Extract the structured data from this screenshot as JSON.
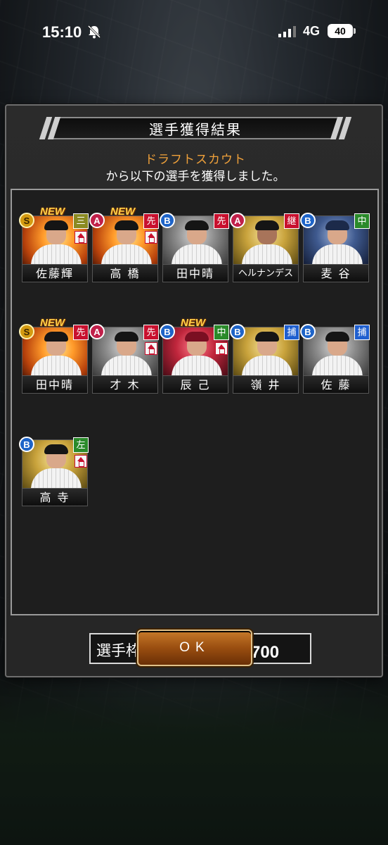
{
  "status_bar": {
    "time": "15:10",
    "network": "4G",
    "battery": "40"
  },
  "dialog": {
    "title": "選手獲得結果",
    "source_name": "ドラフトスカウト",
    "message": "から以下の選手を獲得しました。",
    "counter_label": "選手枠：",
    "counter_value": "623／700",
    "ok_label": "OK"
  },
  "players": [
    {
      "name": "佐藤輝",
      "rank": "S",
      "position": "三",
      "new": "NEW",
      "up": true
    },
    {
      "name": "高 橋",
      "rank": "A",
      "position": "先",
      "new": "NEW",
      "up": true
    },
    {
      "name": "田中晴",
      "rank": "B",
      "position": "先"
    },
    {
      "name": "ヘルナンデス",
      "rank": "A",
      "position": "継"
    },
    {
      "name": "麦 谷",
      "rank": "B",
      "position": "中"
    },
    {
      "name": "田中晴",
      "rank": "S",
      "position": "先",
      "new": "NEW"
    },
    {
      "name": "才 木",
      "rank": "A",
      "position": "先",
      "up": true
    },
    {
      "name": "辰 己",
      "rank": "B",
      "position": "中",
      "new": "NEW",
      "up": true
    },
    {
      "name": "嶺 井",
      "rank": "B",
      "position": "捕"
    },
    {
      "name": "佐 藤",
      "rank": "B",
      "position": "捕"
    },
    {
      "name": "高 寺",
      "rank": "B",
      "position": "左",
      "up": true
    }
  ],
  "colors": {
    "source_name": "#f0a13a",
    "rank_S": "#d49a10",
    "rank_A": "#c0204a",
    "rank_B": "#1e64c8",
    "ok_button": "#9a4e10"
  }
}
